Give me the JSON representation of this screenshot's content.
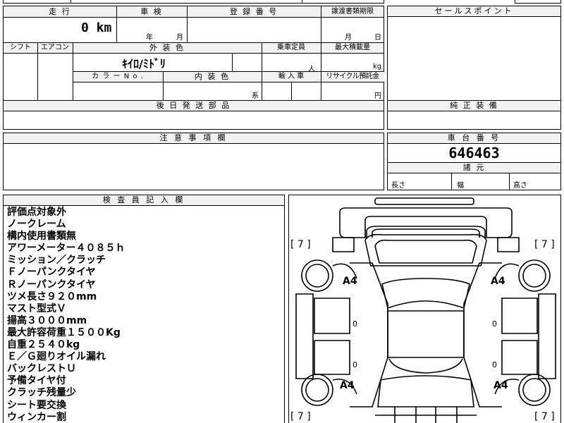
{
  "header": {
    "mileage_label": "走 行",
    "inspection_label": "車 検",
    "registration_label": "登 録 番 号",
    "transfer_docs_label": "譲渡書類期限",
    "mileage_value": "0 km",
    "year_unit": "年",
    "month_unit": "月",
    "transfer_month": "月",
    "transfer_day": "日"
  },
  "specs": {
    "shift_label": "シフト",
    "aircon_label": "エアコン",
    "exterior_color_label": "外 装 色",
    "capacity_label": "乗車定員",
    "max_load_label": "最大積載量",
    "exterior_color_value": "ｷｲﾛ/ﾐﾄﾞﾘ",
    "capacity_unit": "人",
    "max_load_unit": "kg",
    "color_no_label": "カ ラ ー N o .",
    "interior_color_label": "内 装 色",
    "import_label": "輸 入 車",
    "recycle_label": "リサイクル預託金",
    "interior_unit": "系",
    "recycle_unit": "円",
    "later_parts_label": "後 日 発 送 部 品"
  },
  "sales_point": {
    "title": "セールスポイント"
  },
  "genuine": {
    "title": "純 正 装 備"
  },
  "caution": {
    "title": "注 意 事 項 欄"
  },
  "chassis": {
    "title": "車 台 番 号",
    "number": "646463",
    "dimensions_title": "諸 元",
    "length_label": "長さ",
    "width_label": "幅",
    "height_label": "高さ"
  },
  "inspector": {
    "title": "検 査 員 記 入 欄",
    "notes": [
      "評価点対象外",
      "ノークレーム",
      "構内使用書類無",
      "アワーメーター４０８５ｈ",
      "ミッション／クラッチ",
      "Ｆノーパンクタイヤ",
      "Ｒノーパンクタイヤ",
      "ツメ長さ９２０mm",
      "マスト型式Ｖ",
      "揚高３０００mm",
      "最大許容荷重１５００Kg",
      "自重２５４０kg",
      "Ｅ／Ｇ廻りオイル漏れ",
      "バックレストＵ",
      "予備タイヤ付",
      "クラッチ残量少",
      "シート要交換",
      "ウィンカー割"
    ]
  },
  "diagram": {
    "bracket_tl": "[ 7 ]",
    "bracket_tr": "[ 7 ]",
    "bracket_bl": "[ 7 ]",
    "bracket_br": "[ 7 ]",
    "tire_fl": "A4",
    "tire_fr": "A4",
    "tire_rl": "A4",
    "tire_rr": "A4",
    "side_l1": "0",
    "side_l2": "0",
    "side_r1": "0",
    "side_r2": "0"
  }
}
